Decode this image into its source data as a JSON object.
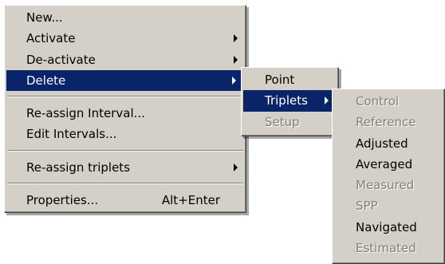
{
  "main_menu": {
    "items": [
      {
        "label": "New..."
      },
      {
        "label": "Activate"
      },
      {
        "label": "De-activate"
      },
      {
        "label": "Delete"
      },
      {
        "label": "Re-assign Interval..."
      },
      {
        "label": "Edit Intervals..."
      },
      {
        "label": "Re-assign triplets"
      },
      {
        "label": "Properties...",
        "shortcut": "Alt+Enter"
      }
    ]
  },
  "delete_submenu": {
    "items": [
      {
        "label": "Point"
      },
      {
        "label": "Triplets"
      },
      {
        "label": "Setup"
      }
    ]
  },
  "triplets_submenu": {
    "items": [
      {
        "label": "Control"
      },
      {
        "label": "Reference"
      },
      {
        "label": "Adjusted"
      },
      {
        "label": "Averaged"
      },
      {
        "label": "Measured"
      },
      {
        "label": "SPP"
      },
      {
        "label": "Navigated"
      },
      {
        "label": "Estimated"
      }
    ]
  },
  "colors": {
    "menu_background": "#d4d0c8",
    "highlight": "#0a246a",
    "highlight_text": "#ffffff",
    "disabled_text": "#808080"
  },
  "icons": {
    "submenu_arrow": "submenu-arrow-icon"
  }
}
